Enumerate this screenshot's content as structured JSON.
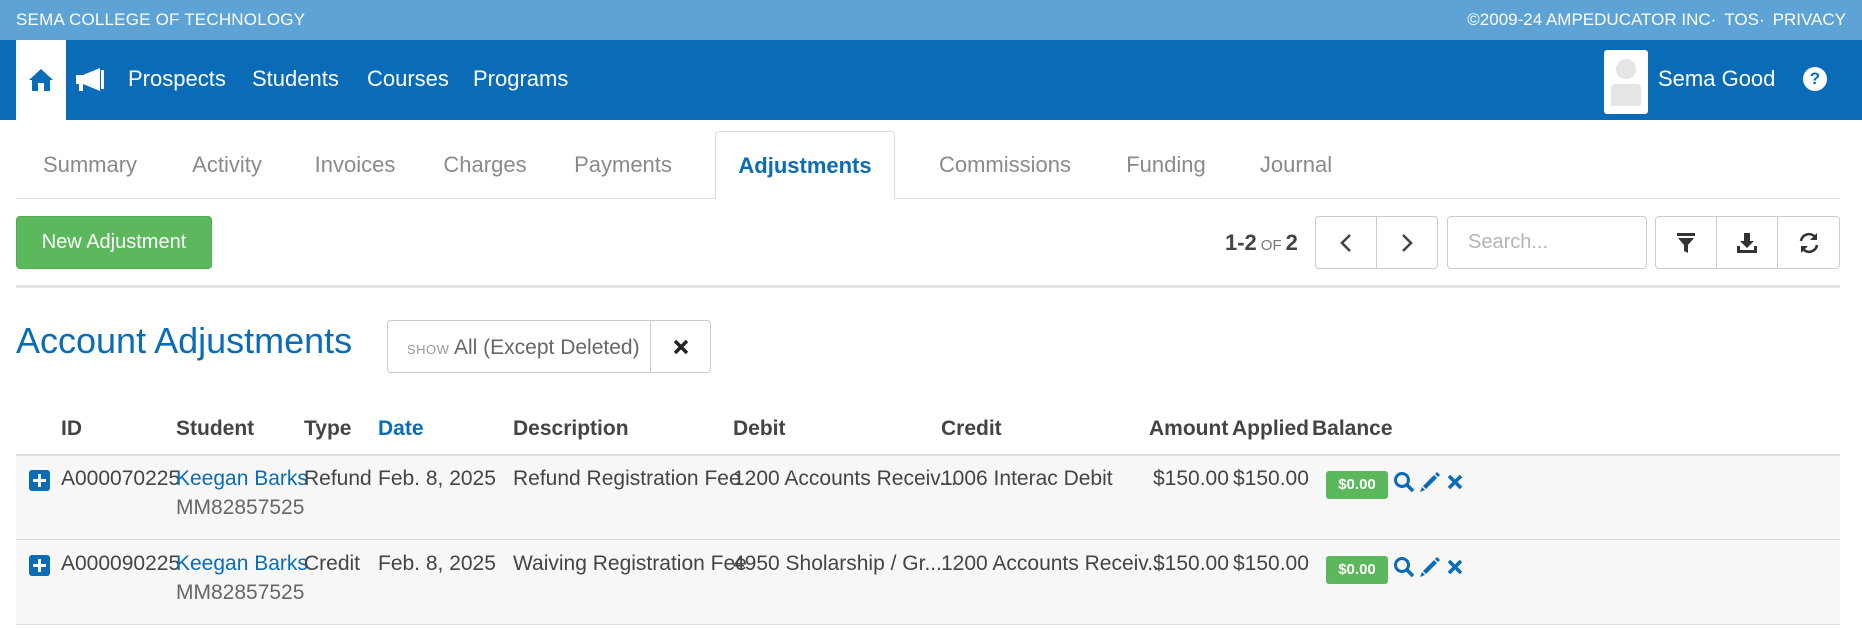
{
  "topbar": {
    "org": "SEMA COLLEGE OF TECHNOLOGY",
    "copyright": "©2009-24 AMPEDUCATOR INC",
    "tos": "TOS",
    "privacy": "PRIVACY"
  },
  "nav": {
    "items": [
      "Prospects",
      "Students",
      "Courses",
      "Programs"
    ],
    "user": "Sema Good"
  },
  "tabs": [
    {
      "label": "Summary",
      "active": false
    },
    {
      "label": "Activity",
      "active": false
    },
    {
      "label": "Invoices",
      "active": false
    },
    {
      "label": "Charges",
      "active": false
    },
    {
      "label": "Payments",
      "active": false
    },
    {
      "label": "Adjustments",
      "active": true
    },
    {
      "label": "Commissions",
      "active": false
    },
    {
      "label": "Funding",
      "active": false
    },
    {
      "label": "Journal",
      "active": false
    }
  ],
  "toolbar": {
    "new_label": "New Adjustment",
    "pager_range": "1-2",
    "pager_of": "OF",
    "pager_total": "2",
    "search_placeholder": "Search..."
  },
  "section": {
    "title": "Account Adjustments",
    "show_label": "SHOW",
    "show_value": "All (Except Deleted)"
  },
  "table": {
    "columns": [
      "ID",
      "Student",
      "Type",
      "Date",
      "Description",
      "Debit",
      "Credit",
      "Amount",
      "Applied",
      "Balance"
    ],
    "sorted_column": "Date",
    "rows": [
      {
        "id": "A000070225",
        "student": "Keegan Barks",
        "student_no": "MM82857525",
        "type": "Refund",
        "date": "Feb. 8, 2025",
        "description": "Refund Registration Fee",
        "debit": "1200 Accounts Receiv...",
        "credit": "1006 Interac Debit",
        "amount": "$150.00",
        "applied": "$150.00",
        "balance": "$0.00"
      },
      {
        "id": "A000090225",
        "student": "Keegan Barks",
        "student_no": "MM82857525",
        "type": "Credit",
        "date": "Feb. 8, 2025",
        "description": "Waiving Registration Fee",
        "debit": "4950 Sholarship / Gr...",
        "credit": "1200 Accounts Receiv...",
        "amount": "$150.00",
        "applied": "$150.00",
        "balance": "$0.00"
      }
    ]
  },
  "colors": {
    "brand_blue": "#0a6bb6",
    "top_strip": "#5ea3d6",
    "success_green": "#5cb85c"
  }
}
